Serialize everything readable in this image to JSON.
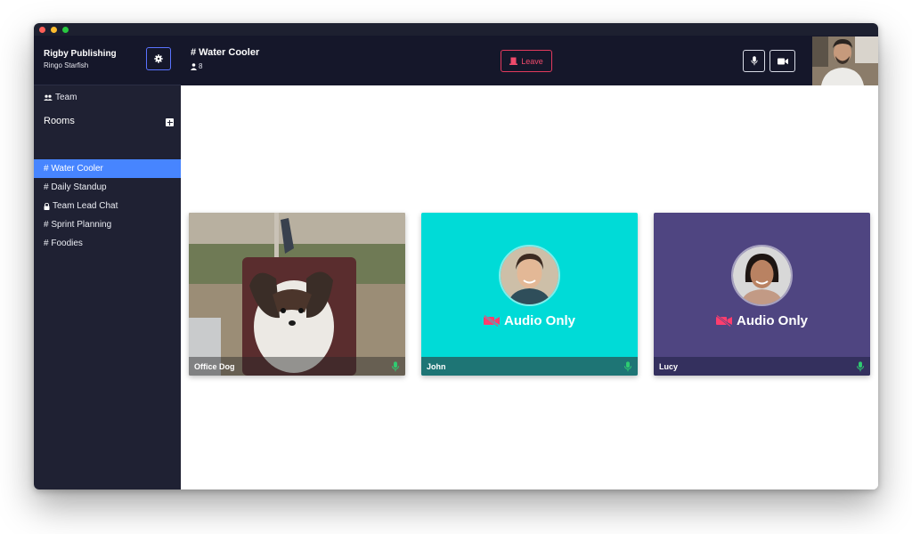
{
  "workspace": {
    "name": "Rigby Publishing",
    "user": "Ringo Starfish"
  },
  "sidebar": {
    "team_label": "Team",
    "rooms_label": "Rooms",
    "rooms": [
      {
        "label": "# Water Cooler",
        "active": true
      },
      {
        "label": "# Daily Standup",
        "active": false
      },
      {
        "label": "Team Lead Chat",
        "active": false,
        "locked": true
      },
      {
        "label": "# Sprint Planning",
        "active": false
      },
      {
        "label": "# Foodies",
        "active": false
      }
    ]
  },
  "header": {
    "room_title": "# Water Cooler",
    "member_count": "8",
    "leave_label": "Leave"
  },
  "tiles": [
    {
      "name": "Office Dog",
      "mode": "video"
    },
    {
      "name": "John",
      "mode": "audio",
      "audio_label": "Audio Only"
    },
    {
      "name": "Lucy",
      "mode": "audio",
      "audio_label": "Audio Only"
    }
  ],
  "colors": {
    "accent": "#4785ff",
    "leave": "#e23a5d",
    "tile_john": "#00dbd7",
    "tile_lucy": "#4f4581",
    "mic_on": "#2ecc71",
    "cam_off": "#ff3d6e"
  },
  "icons": [
    "gear-icon",
    "team-icon",
    "add-room-icon",
    "lock-icon",
    "user-icon",
    "leave-door-icon",
    "microphone-icon",
    "video-camera-icon",
    "camera-off-icon"
  ]
}
